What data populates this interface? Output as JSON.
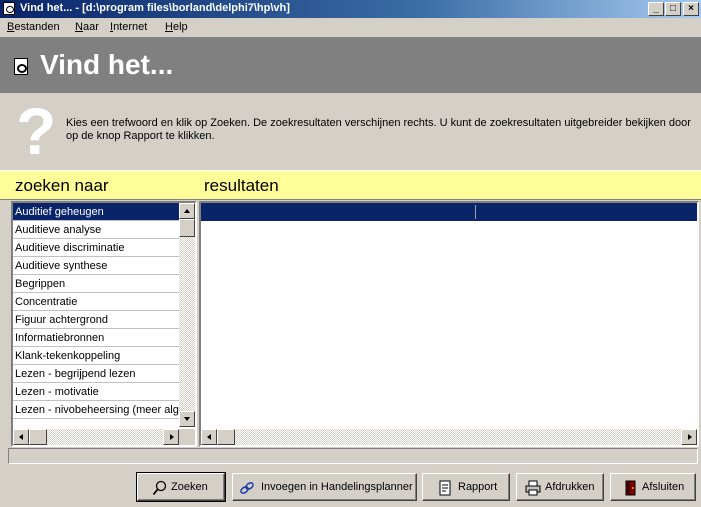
{
  "window": {
    "title": "Vind het... - [d:\\program files\\borland\\delphi7\\hp\\vh]",
    "minimize_label": "_",
    "maximize_label": "□",
    "close_label": "×"
  },
  "menu": {
    "items": [
      {
        "label": "Bestanden"
      },
      {
        "label": "Naar"
      },
      {
        "label": "Internet"
      },
      {
        "label": "Help"
      }
    ]
  },
  "banner": {
    "title": "Vind het...",
    "icon": "document-search-icon"
  },
  "help": {
    "symbol": "?",
    "text": "Kies een trefwoord en klik op Zoeken.  De zoekresultaten verschijnen rechts. U kunt de zoekresultaten uitgebreider bekijken door op de knop Rapport te klikken."
  },
  "headers": {
    "search": "zoeken naar",
    "results": "resultaten"
  },
  "search_list": {
    "selected_index": 0,
    "items": [
      "Auditief geheugen",
      "Auditieve analyse",
      "Auditieve discriminatie",
      "Auditieve synthese",
      "Begrippen",
      "Concentratie",
      "Figuur achtergrond",
      "Informatiebronnen",
      "Klank-tekenkoppeling",
      "Lezen - begrijpend lezen",
      "Lezen - motivatie",
      "Lezen - nivobeheersing (meer alge"
    ]
  },
  "buttons": {
    "search": {
      "label": "Zoeken",
      "icon": "magnifier-icon"
    },
    "insert": {
      "label": "Invoegen in Handelingsplanner",
      "icon": "link-icon"
    },
    "report": {
      "label": "Rapport",
      "icon": "report-icon"
    },
    "print": {
      "label": "Afdrukken",
      "icon": "printer-icon"
    },
    "close": {
      "label": "Afsluiten",
      "icon": "exit-door-icon"
    }
  },
  "colors": {
    "title_bar": "#0a246a",
    "banner": "#808080",
    "header_row": "#ffff99",
    "selection": "#0a246a"
  }
}
